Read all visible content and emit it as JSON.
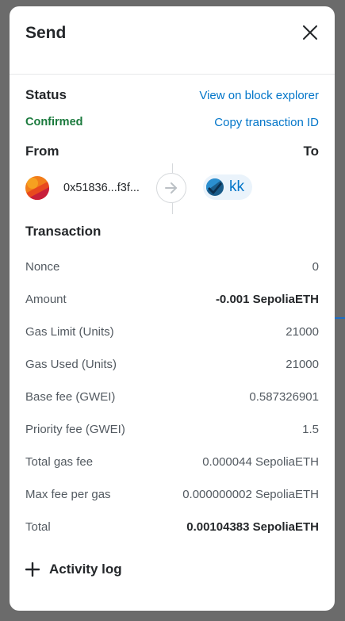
{
  "modal": {
    "title": "Send"
  },
  "status": {
    "heading": "Status",
    "state": "Confirmed",
    "view_explorer_link": "View on block explorer",
    "copy_tx_link": "Copy transaction ID"
  },
  "addresses": {
    "from_label": "From",
    "to_label": "To",
    "from_address": "0x51836...f3f...",
    "to_name": "kk"
  },
  "transaction": {
    "heading": "Transaction",
    "rows": [
      {
        "label": "Nonce",
        "value": "0"
      },
      {
        "label": "Amount",
        "value": "-0.001 SepoliaETH"
      },
      {
        "label": "Gas Limit (Units)",
        "value": "21000"
      },
      {
        "label": "Gas Used (Units)",
        "value": "21000"
      },
      {
        "label": "Base fee (GWEI)",
        "value": "0.587326901"
      },
      {
        "label": "Priority fee (GWEI)",
        "value": "1.5"
      },
      {
        "label": "Total gas fee",
        "value": "0.000044 SepoliaETH"
      },
      {
        "label": "Max fee per gas",
        "value": "0.000000002 SepoliaETH"
      },
      {
        "label": "Total",
        "value": "0.00104383 SepoliaETH"
      }
    ]
  },
  "activity": {
    "label": "Activity log"
  },
  "colors": {
    "accent": "#0376c9",
    "success": "#1b7a3d",
    "text_primary": "#24272a",
    "text_secondary": "#535a61"
  },
  "icons": {
    "close": "close-icon",
    "arrow": "arrow-right-icon",
    "plus": "plus-icon"
  }
}
